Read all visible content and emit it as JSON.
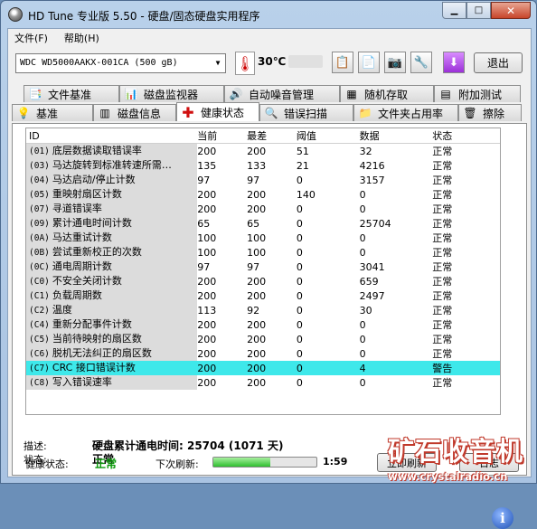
{
  "window": {
    "title": "HD Tune 专业版 5.50 - 硬盘/固态硬盘实用程序"
  },
  "menu": [
    "文件(F)",
    "帮助(H)"
  ],
  "toolbar": {
    "drive_model": "WDC    WD5000AAKX-001CA (500 gB)",
    "temperature": "30℃",
    "exit_label": "退出",
    "buttons": [
      "copy-icon",
      "copy-text-icon",
      "camera-icon",
      "settings-icon",
      "save-icon"
    ]
  },
  "tabs_back": [
    {
      "label": "文件基准",
      "icon": "file-benchmark-icon"
    },
    {
      "label": "磁盘监视器",
      "icon": "disk-monitor-icon"
    },
    {
      "label": "自动噪音管理",
      "icon": "speaker-icon"
    },
    {
      "label": "随机存取",
      "icon": "random-access-icon"
    },
    {
      "label": "附加测试",
      "icon": "extra-tests-icon"
    }
  ],
  "tabs_front": [
    {
      "label": "基准",
      "icon": "benchmark-icon"
    },
    {
      "label": "磁盘信息",
      "icon": "disk-info-icon"
    },
    {
      "label": "健康状态",
      "icon": "health-cross-icon",
      "active": true
    },
    {
      "label": "错误扫描",
      "icon": "error-scan-icon"
    },
    {
      "label": "文件夹占用率",
      "icon": "folder-icon"
    },
    {
      "label": "擦除",
      "icon": "erase-icon"
    }
  ],
  "table": {
    "headers": {
      "id": "ID",
      "current": "当前",
      "worst": "最差",
      "threshold": "阈值",
      "data": "数据",
      "status": "状态"
    },
    "rows": [
      {
        "code": "(01)",
        "name": "底层数据读取错误率",
        "current": "200",
        "worst": "200",
        "threshold": "51",
        "data": "32",
        "status": "正常"
      },
      {
        "code": "(03)",
        "name": "马达旋转到标准转速所需…",
        "current": "135",
        "worst": "133",
        "threshold": "21",
        "data": "4216",
        "status": "正常"
      },
      {
        "code": "(04)",
        "name": "马达启动/停止计数",
        "current": "97",
        "worst": "97",
        "threshold": "0",
        "data": "3157",
        "status": "正常"
      },
      {
        "code": "(05)",
        "name": "重映射扇区计数",
        "current": "200",
        "worst": "200",
        "threshold": "140",
        "data": "0",
        "status": "正常"
      },
      {
        "code": "(07)",
        "name": "寻道错误率",
        "current": "200",
        "worst": "200",
        "threshold": "0",
        "data": "0",
        "status": "正常"
      },
      {
        "code": "(09)",
        "name": "累计通电时间计数",
        "current": "65",
        "worst": "65",
        "threshold": "0",
        "data": "25704",
        "status": "正常"
      },
      {
        "code": "(0A)",
        "name": "马达重试计数",
        "current": "100",
        "worst": "100",
        "threshold": "0",
        "data": "0",
        "status": "正常"
      },
      {
        "code": "(0B)",
        "name": "尝试重新校正的次数",
        "current": "100",
        "worst": "100",
        "threshold": "0",
        "data": "0",
        "status": "正常"
      },
      {
        "code": "(0C)",
        "name": "通电周期计数",
        "current": "97",
        "worst": "97",
        "threshold": "0",
        "data": "3041",
        "status": "正常"
      },
      {
        "code": "(C0)",
        "name": "不安全关闭计数",
        "current": "200",
        "worst": "200",
        "threshold": "0",
        "data": "659",
        "status": "正常"
      },
      {
        "code": "(C1)",
        "name": "负载周期数",
        "current": "200",
        "worst": "200",
        "threshold": "0",
        "data": "2497",
        "status": "正常"
      },
      {
        "code": "(C2)",
        "name": "温度",
        "current": "113",
        "worst": "92",
        "threshold": "0",
        "data": "30",
        "status": "正常"
      },
      {
        "code": "(C4)",
        "name": "重新分配事件计数",
        "current": "200",
        "worst": "200",
        "threshold": "0",
        "data": "0",
        "status": "正常"
      },
      {
        "code": "(C5)",
        "name": "当前待映射的扇区数",
        "current": "200",
        "worst": "200",
        "threshold": "0",
        "data": "0",
        "status": "正常"
      },
      {
        "code": "(C6)",
        "name": "脱机无法纠正的扇区数",
        "current": "200",
        "worst": "200",
        "threshold": "0",
        "data": "0",
        "status": "正常"
      },
      {
        "code": "(C7)",
        "name": "CRC 接口错误计数",
        "current": "200",
        "worst": "200",
        "threshold": "0",
        "data": "4",
        "status": "警告",
        "warning": true
      },
      {
        "code": "(C8)",
        "name": "写入错误速率",
        "current": "200",
        "worst": "200",
        "threshold": "0",
        "data": "0",
        "status": "正常"
      }
    ]
  },
  "description": {
    "desc_label": "描述:",
    "desc_value": "硬盘累计通电时间: 25704 (1071 天)",
    "status_label": "状态:",
    "status_value": "正常"
  },
  "footer": {
    "health_label": "健康状态:",
    "health_value": "正常",
    "refresh_label": "下次刷新:",
    "refresh_progress": 0.55,
    "countdown": "1:59",
    "refresh_now": "立即刷新",
    "log": "日志"
  },
  "watermark": {
    "title": "矿石收音机",
    "url": "www.crystalradio.cn"
  },
  "colors": {
    "warning_row": "#3ee8ea",
    "healthy": "#0a9a0a"
  }
}
